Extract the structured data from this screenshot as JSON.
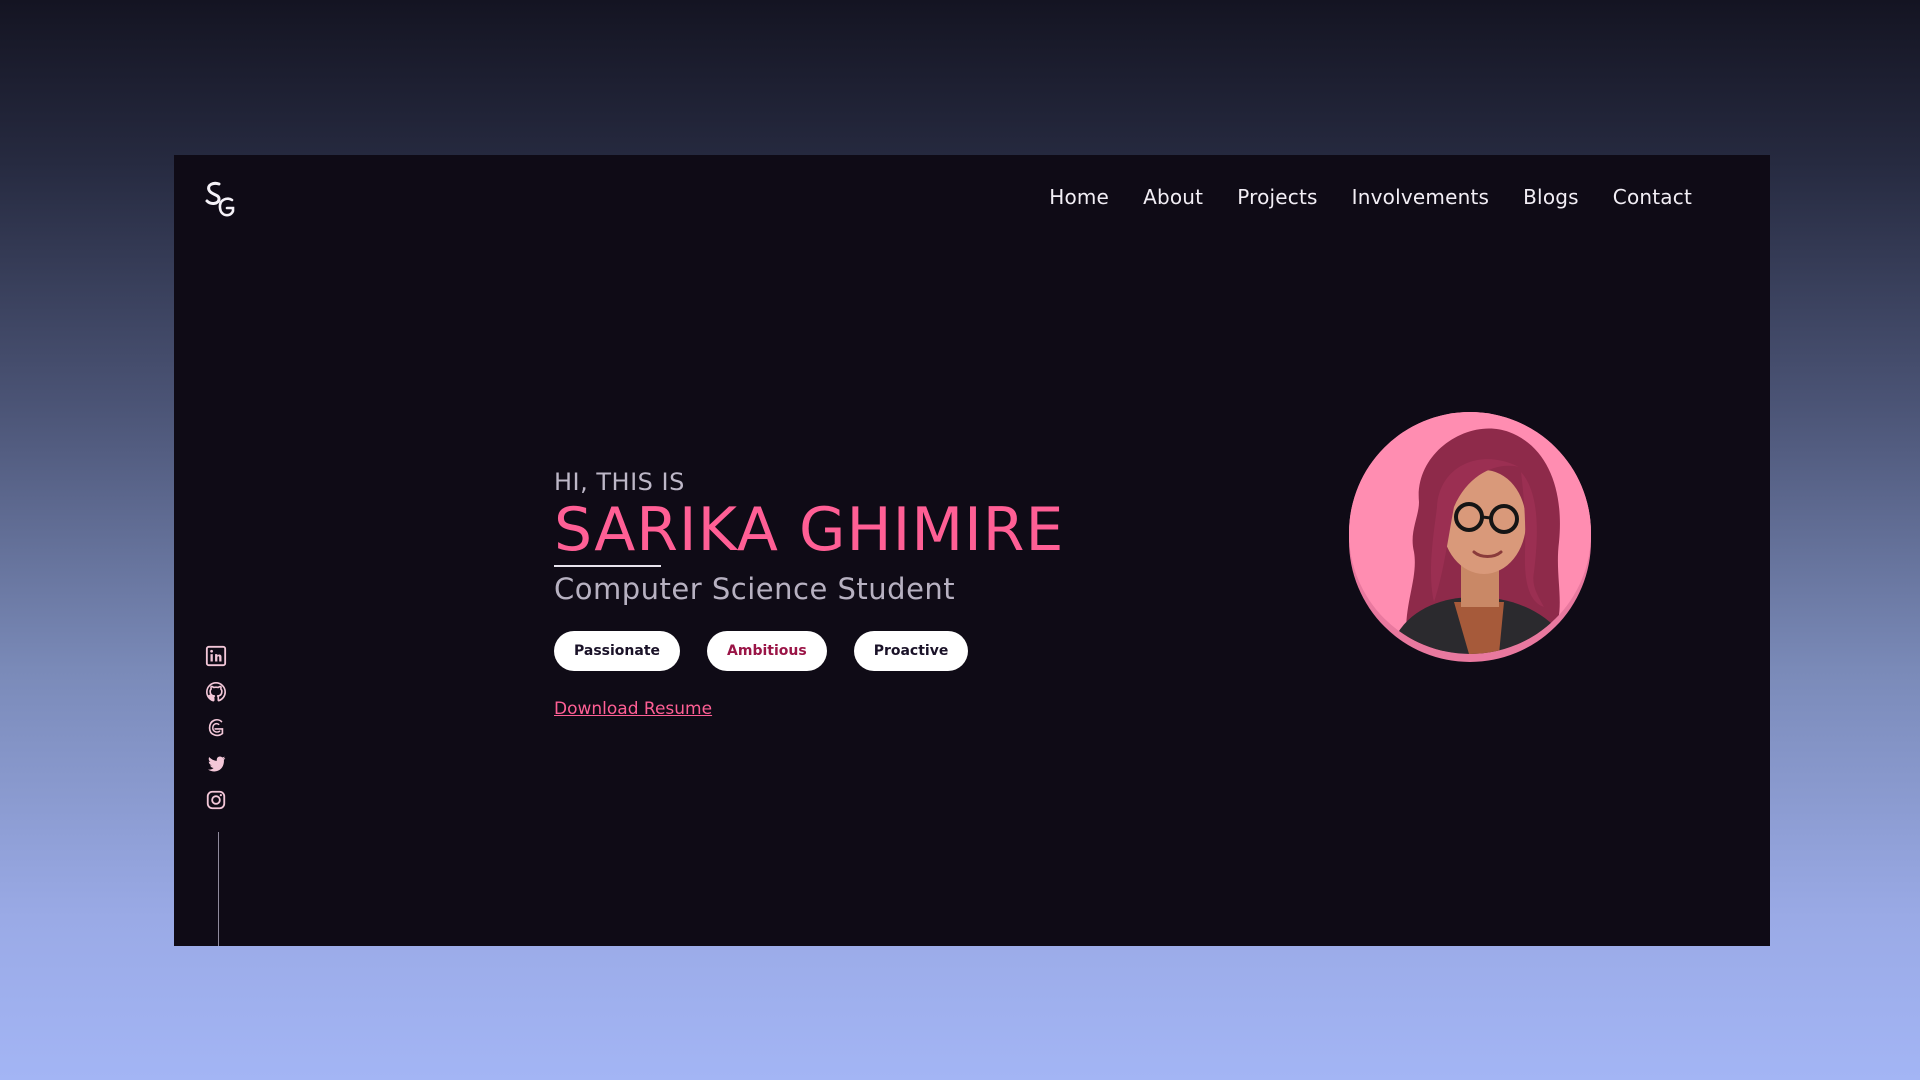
{
  "brand": {
    "logo_text": "SG"
  },
  "nav": {
    "items": [
      {
        "label": "Home"
      },
      {
        "label": "About"
      },
      {
        "label": "Projects"
      },
      {
        "label": "Involvements"
      },
      {
        "label": "Blogs"
      },
      {
        "label": "Contact"
      }
    ]
  },
  "hero": {
    "greeting": "HI, THIS IS",
    "name": "SARIKA GHIMIRE",
    "role": "Computer Science Student",
    "tags": [
      {
        "label": "Passionate"
      },
      {
        "label": "Ambitious"
      },
      {
        "label": "Proactive"
      }
    ],
    "resume_link": "Download Resume"
  },
  "social": {
    "icons": [
      "linkedin-icon",
      "github-icon",
      "medium-icon",
      "twitter-icon",
      "instagram-icon"
    ]
  },
  "colors": {
    "accent": "#ff5f95",
    "page_bg": "#0f0b16",
    "avatar_bg": "#ff8db1"
  }
}
